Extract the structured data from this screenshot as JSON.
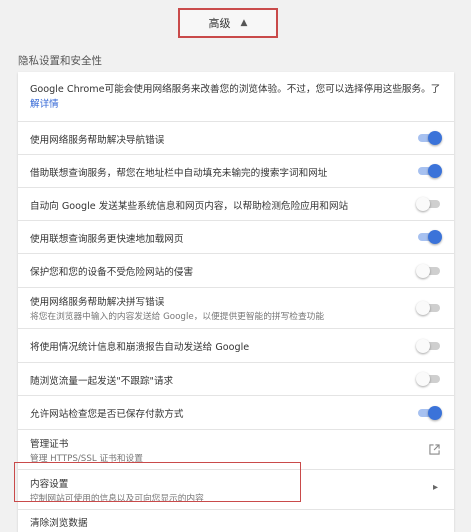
{
  "advanced": {
    "label": "高级"
  },
  "section": {
    "title": "隐私设置和安全性"
  },
  "intro": {
    "text": "Google Chrome可能会使用网络服务来改善您的浏览体验。不过，您可以选择停用这些服务。了",
    "link": "解详情"
  },
  "settings": [
    {
      "label": "使用网络服务帮助解决导航错误",
      "state": "on"
    },
    {
      "label": "借助联想查询服务，帮您在地址栏中自动填充未输完的搜索字词和网址",
      "state": "on"
    },
    {
      "label": "自动向 Google 发送某些系统信息和网页内容，以帮助检测危险应用和网站",
      "state": "off"
    },
    {
      "label": "使用联想查询服务更快速地加载网页",
      "state": "on"
    },
    {
      "label": "保护您和您的设备不受危险网站的侵害",
      "state": "off"
    },
    {
      "label": "使用网络服务帮助解决拼写错误",
      "sub": "将您在浏览器中输入的内容发送给 Google，以便提供更智能的拼写检查功能",
      "state": "off"
    },
    {
      "label": "将使用情况统计信息和崩溃报告自动发送给 Google",
      "state": "off"
    },
    {
      "label": "随浏览流量一起发送\"不跟踪\"请求",
      "state": "off"
    },
    {
      "label": "允许网站检查您是否已保存付款方式",
      "state": "on"
    }
  ],
  "certificates": {
    "label": "管理证书",
    "sub": "管理 HTTPS/SSL 证书和设置"
  },
  "content_settings": {
    "label": "内容设置",
    "sub": "控制网站可使用的信息以及可向您显示的内容"
  },
  "clear_data": {
    "label": "清除浏览数据"
  },
  "colors": {
    "accent": "#3b73d9",
    "highlight_border": "#c94a4a"
  }
}
